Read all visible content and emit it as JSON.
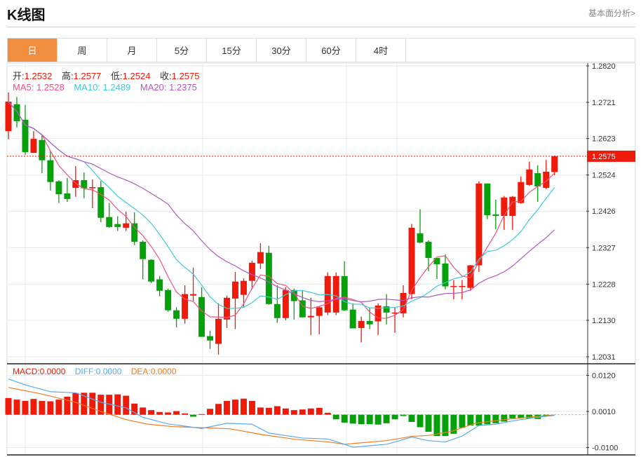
{
  "header": {
    "title": "K线图",
    "link": "基本面分析>"
  },
  "tabs": [
    {
      "label": "日",
      "active": true
    },
    {
      "label": "周"
    },
    {
      "label": "月"
    },
    {
      "label": "5分"
    },
    {
      "label": "15分"
    },
    {
      "label": "30分"
    },
    {
      "label": "60分"
    },
    {
      "label": "4时"
    }
  ],
  "ohlc_legend": {
    "open_label": "开:",
    "open": "1.2532",
    "high_label": "高:",
    "high": "1.2577",
    "low_label": "低:",
    "low": "1.2524",
    "close_label": "收:",
    "close": "1.2575"
  },
  "ma_legend": {
    "ma5": "MA5: 1.2528",
    "ma10": "MA10: 1.2489",
    "ma20": "MA20: 1.2375"
  },
  "macd_legend": {
    "macd": "MACD:0.0000",
    "diff": "DIFF:0.0000",
    "dea": "DEA:0.0000"
  },
  "current_price": "1.2575",
  "colors": {
    "up": "#f01a0a",
    "down": "#06a10a",
    "accent": "#f18d3f",
    "ma5": "#f0527e",
    "ma10": "#3fc9dc",
    "ma20": "#b356c5",
    "diff": "#5aaaf0",
    "dea": "#f57a1f"
  },
  "chart_data": {
    "type": "candlestick",
    "price_axis": {
      "ticks": [
        "1.2820",
        "1.2721",
        "1.2623",
        "1.2524",
        "1.2426",
        "1.2327",
        "1.2228",
        "1.2130",
        "1.2031"
      ],
      "ylim": [
        1.2031,
        1.282
      ]
    },
    "macd_axis": {
      "ticks": [
        "0.0120",
        "0.0010",
        "-0.0100"
      ]
    },
    "candles": [
      [
        1.2643,
        1.2748,
        1.2621,
        1.2723
      ],
      [
        1.2716,
        1.2736,
        1.2653,
        1.267
      ],
      [
        1.2674,
        1.2714,
        1.2579,
        1.2586
      ],
      [
        1.2584,
        1.2643,
        1.2584,
        1.2622
      ],
      [
        1.2619,
        1.2632,
        1.2529,
        1.2564
      ],
      [
        1.2564,
        1.259,
        1.2482,
        1.2505
      ],
      [
        1.2507,
        1.251,
        1.2448,
        1.2472
      ],
      [
        1.2474,
        1.2516,
        1.2451,
        1.2459
      ],
      [
        1.2489,
        1.2548,
        1.2465,
        1.251
      ],
      [
        1.251,
        1.2531,
        1.2461,
        1.2488
      ],
      [
        1.2488,
        1.2512,
        1.2434,
        1.2491
      ],
      [
        1.2491,
        1.2508,
        1.2396,
        1.2408
      ],
      [
        1.241,
        1.2448,
        1.2381,
        1.2383
      ],
      [
        1.2391,
        1.2412,
        1.2372,
        1.2383
      ],
      [
        1.2381,
        1.2425,
        1.2372,
        1.2393
      ],
      [
        1.2393,
        1.2423,
        1.2334,
        1.2343
      ],
      [
        1.2343,
        1.2347,
        1.2241,
        1.2296
      ],
      [
        1.2294,
        1.2296,
        1.2231,
        1.2235
      ],
      [
        1.2241,
        1.225,
        1.2195,
        1.221
      ],
      [
        1.2212,
        1.2216,
        1.2153,
        1.2157
      ],
      [
        1.2157,
        1.2165,
        1.2111,
        1.2134
      ],
      [
        1.2134,
        1.2225,
        1.2121,
        1.2201
      ],
      [
        1.2197,
        1.2273,
        1.2182,
        1.2201
      ],
      [
        1.2193,
        1.222,
        1.2085,
        1.2085
      ],
      [
        1.2087,
        1.2102,
        1.2052,
        1.2075
      ],
      [
        1.2066,
        1.2176,
        1.2037,
        1.2134
      ],
      [
        1.2132,
        1.2197,
        1.2109,
        1.2191
      ],
      [
        1.2189,
        1.2261,
        1.2106,
        1.2235
      ],
      [
        1.2199,
        1.2244,
        1.2165,
        1.2237
      ],
      [
        1.2237,
        1.2292,
        1.2214,
        1.2286
      ],
      [
        1.2284,
        1.2339,
        1.2269,
        1.2315
      ],
      [
        1.2313,
        1.2332,
        1.2172,
        1.2174
      ],
      [
        1.2174,
        1.2225,
        1.2123,
        1.2136
      ],
      [
        1.2136,
        1.222,
        1.213,
        1.2212
      ],
      [
        1.2212,
        1.2216,
        1.2132,
        1.2182
      ],
      [
        1.2184,
        1.2212,
        1.2138,
        1.2138
      ],
      [
        1.2138,
        1.2191,
        1.209,
        1.2142
      ],
      [
        1.2142,
        1.2168,
        1.2092,
        1.2165
      ],
      [
        1.2151,
        1.226,
        1.2144,
        1.225
      ],
      [
        1.2151,
        1.226,
        1.2144,
        1.225
      ],
      [
        1.225,
        1.229,
        1.2155,
        1.2157
      ],
      [
        1.2159,
        1.2176,
        1.2108,
        1.2108
      ],
      [
        1.2109,
        1.214,
        1.207,
        1.2128
      ],
      [
        1.2128,
        1.2163,
        1.2106,
        1.2119
      ],
      [
        1.2127,
        1.2176,
        1.209,
        1.217
      ],
      [
        1.2168,
        1.2201,
        1.2119,
        1.2151
      ],
      [
        1.2149,
        1.2165,
        1.2096,
        1.2151
      ],
      [
        1.2149,
        1.2225,
        1.2138,
        1.2204
      ],
      [
        1.2201,
        1.2391,
        1.2187,
        1.2381
      ],
      [
        1.2366,
        1.2431,
        1.2339,
        1.2341
      ],
      [
        1.2343,
        1.2347,
        1.2263,
        1.2299
      ],
      [
        1.2299,
        1.2299,
        1.2242,
        1.2282
      ],
      [
        1.2284,
        1.2309,
        1.2214,
        1.2222
      ],
      [
        1.2222,
        1.2239,
        1.2187,
        1.2223
      ],
      [
        1.2222,
        1.2239,
        1.2187,
        1.2223
      ],
      [
        1.2218,
        1.228,
        1.221,
        1.2279
      ],
      [
        1.2279,
        1.2507,
        1.2261,
        1.2501
      ],
      [
        1.2501,
        1.2501,
        1.2404,
        1.2415
      ],
      [
        1.2417,
        1.2457,
        1.2377,
        1.2413
      ],
      [
        1.2413,
        1.2467,
        1.2375,
        1.2463
      ],
      [
        1.2413,
        1.2467,
        1.2375,
        1.2465
      ],
      [
        1.2448,
        1.252,
        1.2446,
        1.2505
      ],
      [
        1.2497,
        1.256,
        1.2495,
        1.2539
      ],
      [
        1.2529,
        1.255,
        1.2451,
        1.2493
      ],
      [
        1.2489,
        1.2565,
        1.2486,
        1.2533
      ],
      [
        1.2532,
        1.2577,
        1.2524,
        1.2575
      ]
    ],
    "macd_hist": [
      0.0051,
      0.0046,
      0.0042,
      0.0048,
      0.0042,
      0.0041,
      0.0046,
      0.0055,
      0.0066,
      0.0067,
      0.0067,
      0.0061,
      0.0061,
      0.0062,
      0.0058,
      0.0034,
      0.0022,
      0.0014,
      0.0008,
      0.0007,
      0.0011,
      0.0004,
      -0.0006,
      0.0002,
      0.0018,
      0.0033,
      0.0042,
      0.0046,
      0.0049,
      0.0042,
      0.0022,
      0.0021,
      0.0026,
      0.0019,
      0.0014,
      0.0016,
      0.0019,
      0.0021,
      0.0006,
      -0.0014,
      -0.0024,
      -0.0027,
      -0.0029,
      -0.0029,
      -0.003,
      -0.0026,
      -0.0014,
      -0.0004,
      -0.0022,
      -0.0038,
      -0.0052,
      -0.0065,
      -0.0065,
      -0.0058,
      -0.004,
      -0.0033,
      -0.0033,
      -0.0029,
      -0.0026,
      -0.0021,
      -0.0011,
      -0.001,
      -0.0011,
      -0.0013,
      -0.0004
    ],
    "diff": [
      [
        0,
        0.0109
      ],
      [
        2,
        0.0091
      ],
      [
        5,
        0.007
      ],
      [
        8,
        0.0067
      ],
      [
        11,
        0.0038
      ],
      [
        14,
        0.0021
      ],
      [
        16,
        -0.0008
      ],
      [
        19,
        -0.0028
      ],
      [
        20.5,
        -0.0033
      ],
      [
        23,
        -0.0042
      ],
      [
        26,
        -0.0026
      ],
      [
        29,
        -0.0029
      ],
      [
        31,
        -0.0056
      ],
      [
        35,
        -0.0071
      ],
      [
        38,
        -0.0074
      ],
      [
        40,
        -0.009
      ],
      [
        41,
        -0.0099
      ],
      [
        45,
        -0.009
      ],
      [
        46,
        -0.0083
      ],
      [
        48,
        -0.0068
      ],
      [
        50,
        -0.0079
      ],
      [
        52,
        -0.0083
      ],
      [
        54,
        -0.0065
      ],
      [
        56,
        -0.0033
      ],
      [
        58,
        -0.0029
      ],
      [
        60,
        -0.0019
      ],
      [
        62.6,
        -0.0009
      ],
      [
        65,
        -0.0002
      ]
    ],
    "dea": [
      [
        0,
        0.0083
      ],
      [
        4,
        0.0063
      ],
      [
        8,
        0.0038
      ],
      [
        11,
        0.001
      ],
      [
        14,
        -0.0015
      ],
      [
        16.6,
        -0.0029
      ],
      [
        19.5,
        -0.0036
      ],
      [
        23.4,
        -0.004
      ],
      [
        26.4,
        -0.0043
      ],
      [
        30.3,
        -0.0061
      ],
      [
        34.2,
        -0.0075
      ],
      [
        38.1,
        -0.0083
      ],
      [
        40,
        -0.009
      ],
      [
        45,
        -0.0079
      ],
      [
        48,
        -0.0066
      ],
      [
        50,
        -0.0063
      ],
      [
        52.7,
        -0.0051
      ],
      [
        55.6,
        -0.0026
      ],
      [
        59,
        -0.0015
      ],
      [
        62.6,
        -0.0006
      ],
      [
        65,
        -0.0001
      ]
    ]
  }
}
